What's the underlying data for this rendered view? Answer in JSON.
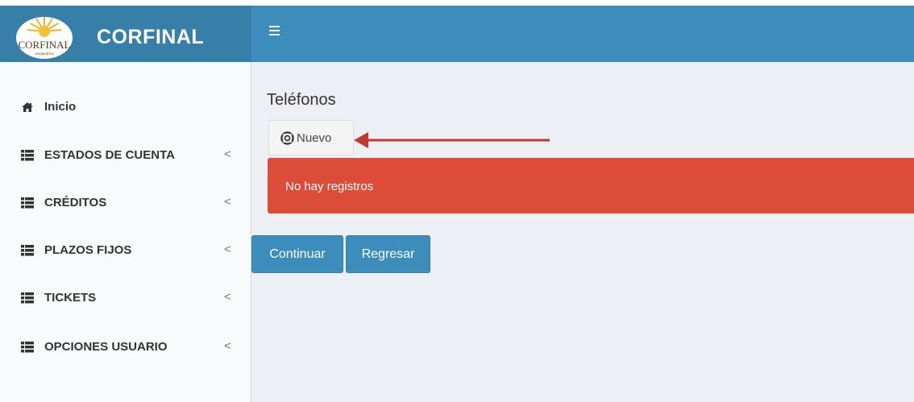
{
  "header": {
    "brand": "CORFINAL",
    "logo_text": "CORFINAL",
    "logo_subtext": "cooperativa",
    "colors": {
      "navbar": "#3c8dbc",
      "logo_area": "#367fa9"
    }
  },
  "sidebar": {
    "items": [
      {
        "label": "Inicio",
        "icon": "home-icon",
        "has_chevron": false
      },
      {
        "label": "ESTADOS DE CUENTA",
        "icon": "list-icon",
        "chevron": "<"
      },
      {
        "label": "CRÉDITOS",
        "icon": "list-icon",
        "chevron": "<"
      },
      {
        "label": "PLAZOS FIJOS",
        "icon": "list-icon",
        "chevron": "<"
      },
      {
        "label": "TICKETS",
        "icon": "list-icon",
        "chevron": "<"
      },
      {
        "label": "OPCIONES USUARIO",
        "icon": "list-icon",
        "chevron": "<"
      }
    ]
  },
  "main": {
    "title": "Teléfonos",
    "new_button": {
      "label": "Nuevo",
      "icon": "life-ring-icon"
    },
    "alert": {
      "text": "No hay registros",
      "color": "#dd4b39"
    },
    "actions": {
      "continue_label": "Continuar",
      "back_label": "Regresar"
    }
  }
}
